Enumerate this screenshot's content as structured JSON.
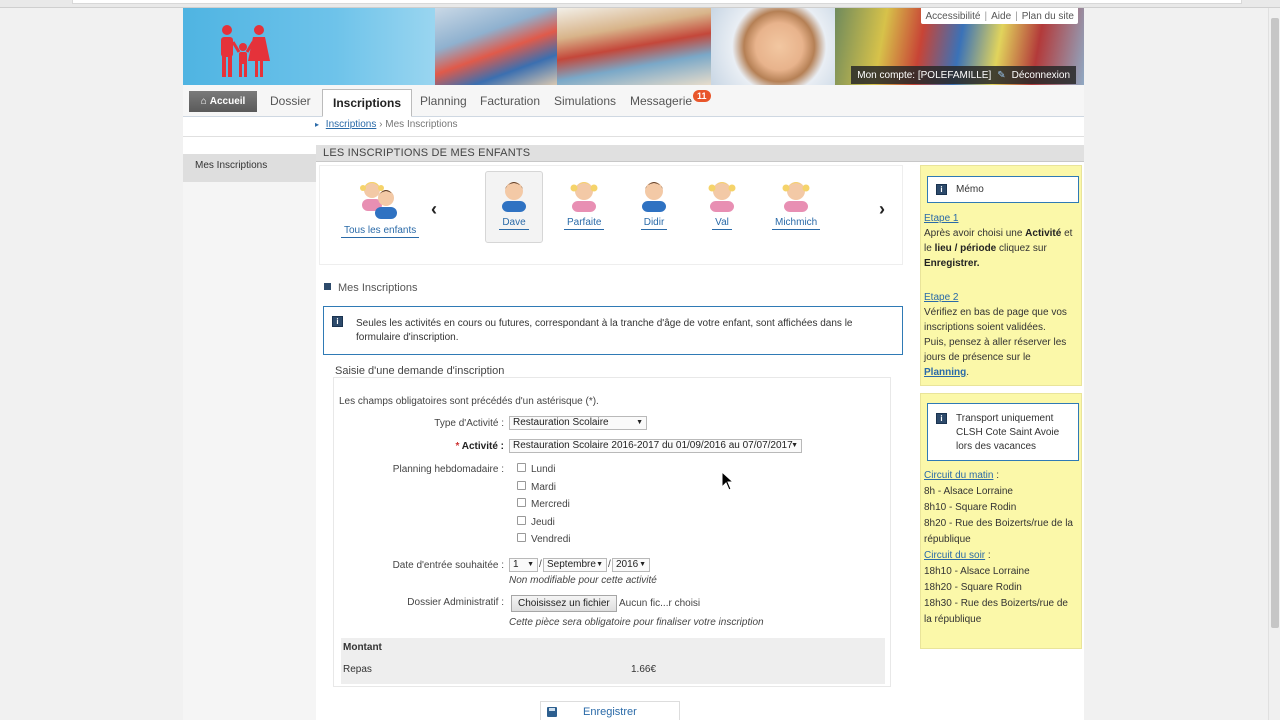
{
  "toplinks": {
    "accessibility": "Accessibilité",
    "help": "Aide",
    "sitemap": "Plan du site"
  },
  "account": {
    "label": "Mon compte: [POLEFAMILLE]",
    "logout": "Déconnexion"
  },
  "nav": {
    "home": "Accueil",
    "tabs": [
      "Dossier",
      "Inscriptions",
      "Planning",
      "Facturation",
      "Simulations",
      "Messagerie"
    ],
    "messages_badge": "11"
  },
  "breadcrumb": {
    "parent": "Inscriptions",
    "sep": "›",
    "current": "Mes Inscriptions"
  },
  "sidebar": {
    "items": [
      "Mes Inscriptions"
    ]
  },
  "section_title": "LES INSCRIPTIONS DE MES ENFANTS",
  "children": {
    "all": "Tous les enfants",
    "prev": "‹",
    "next": "›",
    "list": [
      "Dave",
      "Parfaite",
      "Didir",
      "Val",
      "Michmich"
    ]
  },
  "mes_inscriptions": "Mes Inscriptions",
  "info_text": "Seules les activités en cours ou futures, correspondant à la tranche d'âge de votre enfant, sont affichées dans le formulaire d'inscription.",
  "form": {
    "legend": "Saisie d'une demande d'inscription",
    "required_note": "Les champs obligatoires sont précédés d'un astérisque (*).",
    "type_label": "Type d'Activité :",
    "type_value": "Restauration Scolaire",
    "activity_label": "Activité :",
    "activity_star": "*",
    "activity_value": "Restauration Scolaire 2016-2017 du 01/09/2016 au 07/07/2017",
    "planning_label": "Planning hebdomadaire :",
    "days": [
      "Lundi",
      "Mardi",
      "Mercredi",
      "Jeudi",
      "Vendredi"
    ],
    "date_label": "Date d'entrée souhaitée :",
    "date_day": "1",
    "date_month": "Septembre",
    "date_year": "2016",
    "date_note": "Non modifiable pour cette activité",
    "dossier_label": "Dossier Administratif :",
    "file_button": "Choisissez un fichier",
    "file_none": "Aucun fic...r choisi",
    "file_note": "Cette pièce sera obligatoire pour finaliser votre inscription",
    "montant_title": "Montant",
    "repas_label": "Repas",
    "repas_value": "1.66€",
    "save": "Enregistrer"
  },
  "memo": {
    "title": "Mémo",
    "step1_title": "Etape 1",
    "step1_a": "Après avoir choisi une ",
    "step1_b": "Activité",
    "step1_c": " et",
    "step1_d": "le ",
    "step1_e": "lieu / période",
    "step1_f": " cliquez sur",
    "step1_g": "Enregistrer.",
    "step2_title": "Etape 2",
    "step2_l1": "Vérifiez en bas de page que vos",
    "step2_l2": "inscriptions soient validées.",
    "step2_l3": "Puis, pensez à aller réserver les",
    "step2_l4": "jours de présence sur le",
    "step2_link": "Planning",
    "step2_end": "."
  },
  "transport": {
    "title_l1": "Transport uniquement",
    "title_l2": "CLSH Cote Saint Avoie",
    "title_l3": "lors des vacances",
    "morning_title": "Circuit du matin",
    "morning_colon": " :",
    "m1": "8h - Alsace Lorraine",
    "m2": "8h10 - Square Rodin",
    "m3a": "8h20 - Rue des Boizerts/rue de la",
    "m3b": "république",
    "evening_title": "Circuit du soir",
    "evening_colon": " :",
    "e1": "18h10 - Alsace Lorraine",
    "e2": "18h20 - Square Rodin",
    "e3a": "18h30 - Rue des Boizerts/rue de",
    "e3b": "la république"
  },
  "colors": {
    "accent_blue": "#2a6aa8",
    "badge_orange": "#e8562b",
    "memo_yellow": "#fbf8a9",
    "logo_red": "#e5323a"
  }
}
